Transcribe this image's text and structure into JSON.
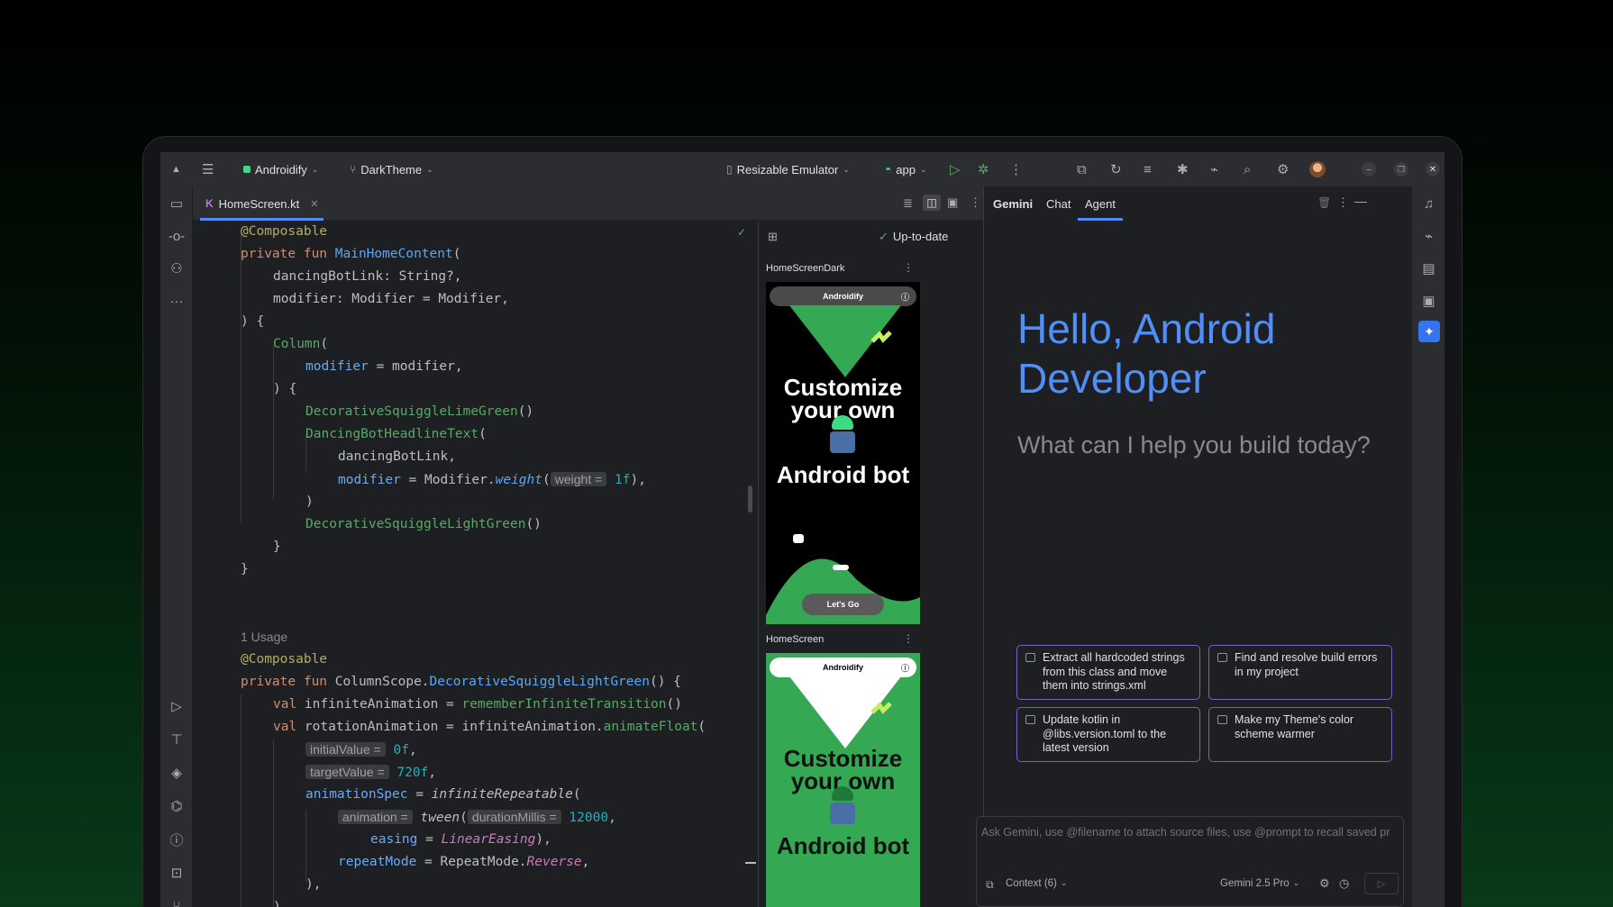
{
  "toolbar": {
    "project": "Androidify",
    "branch": "DarkTheme",
    "device": "Resizable Emulator",
    "run_config": "app"
  },
  "editor": {
    "tab_label": "HomeScreen.kt",
    "lines": [
      "@Composable",
      "private fun MainHomeContent(",
      "    dancingBotLink: String?,",
      "    modifier: Modifier = Modifier,",
      ") {",
      "    Column(",
      "        modifier = modifier,",
      "    ) {",
      "        DecorativeSquiggleLimeGreen()",
      "        DancingBotHeadlineText(",
      "            dancingBotLink,",
      "            modifier = Modifier.weight( weight = 1f),",
      "        )",
      "        DecorativeSquiggleLightGreen()",
      "    }",
      "}",
      "",
      "",
      "1 Usage",
      "@Composable",
      "private fun ColumnScope.DecorativeSquiggleLightGreen() {",
      "    val infiniteAnimation = rememberInfiniteTransition()",
      "    val rotationAnimation = infiniteAnimation.animateFloat(",
      "        initialValue = 0f,",
      "        targetValue = 720f,",
      "        animationSpec = infiniteRepeatable(",
      "            animation = tween( durationMillis = 12000,",
      "                easing = LinearEasing),",
      "            repeatMode = RepeatMode.Reverse,",
      "        ),",
      "    )"
    ]
  },
  "preview": {
    "status": "Up-to-date",
    "cards": [
      {
        "label": "HomeScreenDark",
        "app_title": "Androidify",
        "headline_top": "Customize your own",
        "headline_bottom": "Android bot",
        "cta": "Let's Go"
      },
      {
        "label": "HomeScreen",
        "app_title": "Androidify",
        "headline_top": "Customize your own",
        "headline_bottom": "Android bot"
      }
    ]
  },
  "gemini": {
    "tabs": [
      "Gemini",
      "Chat",
      "Agent"
    ],
    "active_tab": "Agent",
    "greeting": "Hello, Android Developer",
    "subtitle": "What can I help you build today?",
    "suggestions": [
      "Extract all hardcoded strings from this class and move them into strings.xml",
      "Find and resolve build errors in my project",
      "Update kotlin in @libs.version.toml to the latest version",
      "Make my Theme's color scheme warmer"
    ],
    "input_placeholder": "Ask Gemini, use @filename to attach source files, use @prompt to recall saved pr",
    "context_label": "Context (6)",
    "model": "Gemini 2.5 Pro"
  },
  "colors": {
    "accent_blue": "#548af7",
    "gemini_blue": "#4f8ff7",
    "suggestion_border": "#7c5fc2",
    "preview_green": "#34a853"
  }
}
